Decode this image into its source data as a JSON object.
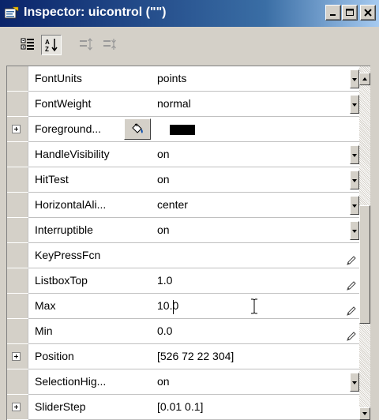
{
  "window": {
    "title": "Inspector:  uicontrol (\"\")",
    "controls": {
      "minimize": "minimize-icon",
      "maximize": "maximize-icon",
      "close": "close-icon"
    }
  },
  "toolbar": {
    "items": [
      {
        "icon": "categorized-view-icon",
        "state": "normal"
      },
      {
        "icon": "alphabetical-sort-icon",
        "state": "pressed"
      },
      {
        "icon": "expand-all-icon",
        "state": "disabled"
      },
      {
        "icon": "collapse-all-icon",
        "state": "disabled"
      }
    ]
  },
  "properties": [
    {
      "name": "FontUnits",
      "value": "points",
      "editor": "dropdown",
      "expandable": false
    },
    {
      "name": "FontWeight",
      "value": "normal",
      "editor": "dropdown",
      "expandable": false
    },
    {
      "name": "Foreground...",
      "value": "",
      "editor": "color",
      "expandable": true,
      "color": "#000000"
    },
    {
      "name": "HandleVisibility",
      "value": "on",
      "editor": "dropdown",
      "expandable": false
    },
    {
      "name": "HitTest",
      "value": "on",
      "editor": "dropdown",
      "expandable": false
    },
    {
      "name": "HorizontalAli...",
      "value": "center",
      "editor": "dropdown",
      "expandable": false
    },
    {
      "name": "Interruptible",
      "value": "on",
      "editor": "dropdown",
      "expandable": false
    },
    {
      "name": "KeyPressFcn",
      "value": "",
      "editor": "text",
      "expandable": false
    },
    {
      "name": "ListboxTop",
      "value": "1.0",
      "editor": "text",
      "expandable": false
    },
    {
      "name": "Max",
      "value": "10.0",
      "editor": "text-active",
      "expandable": false
    },
    {
      "name": "Min",
      "value": "0.0",
      "editor": "text",
      "expandable": false
    },
    {
      "name": "Position",
      "value": "[526 72 22 304]",
      "editor": "none",
      "expandable": true
    },
    {
      "name": "SelectionHig...",
      "value": "on",
      "editor": "dropdown",
      "expandable": false
    },
    {
      "name": "SliderStep",
      "value": "[0.01 0.1]",
      "editor": "none",
      "expandable": true
    }
  ],
  "colors": {
    "titlebar_start": "#0a246a",
    "titlebar_end": "#a6caf0",
    "face": "#d4d0c8",
    "grid_line": "#c0c0c0"
  },
  "scrollbar": {
    "position": 0.55
  }
}
